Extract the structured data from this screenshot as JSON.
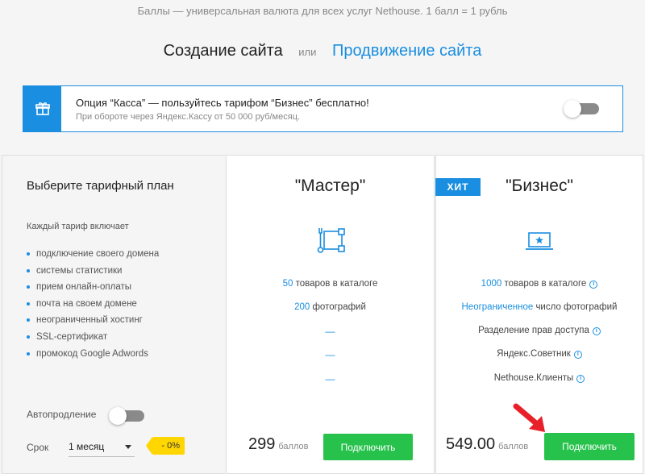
{
  "top_note": "Баллы — универсальная валюта для всех услуг Nethouse. 1 балл = 1 рубль",
  "switcher": {
    "active": "Создание сайта",
    "or": "или",
    "link": "Продвижение сайта"
  },
  "promo": {
    "title": "Опция “Касса” — пользуйтесь тарифом “Бизнес” бесплатно!",
    "subtitle": "При обороте через Яндекс.Кассу от 50 000 руб/месяц."
  },
  "left": {
    "title": "Выберите тарифный план",
    "subtitle": "Каждый тариф включает",
    "features": [
      "подключение своего домена",
      "системы статистики",
      "прием онлайн-оплаты",
      "почта на своем домене",
      "неограниченный хостинг",
      "SSL-сертификат",
      "промокод Google Adwords"
    ],
    "autorenew_label": "Автопродление",
    "term_label": "Срок",
    "term_value": "1 месяц",
    "discount": "- 0%"
  },
  "master": {
    "title": "\"Мастер\"",
    "icon": "tools-icon",
    "f1_num": "50",
    "f1_text": " товаров в каталоге",
    "f2_num": "200",
    "f2_text": " фотографий",
    "dash": "—",
    "price": "299",
    "unit": "баллов",
    "button": "Подключить"
  },
  "business": {
    "badge": "ХИТ",
    "title": "\"Бизнес\"",
    "icon": "laptop-star-icon",
    "f1_num": "1000",
    "f1_text": " товаров в каталоге",
    "f2_num": "Неограниченное",
    "f2_text": " число фотографий",
    "f3": "Разделение прав доступа",
    "f4": "Яндекс.Советник",
    "f5": "Nethouse.Клиенты",
    "info": "i",
    "price": "549.00",
    "unit": "баллов",
    "button": "Подключить"
  },
  "colors": {
    "accent": "#1a8ee0",
    "button": "#27c24c",
    "badge": "#ffd600",
    "arrow": "#e8202a"
  }
}
